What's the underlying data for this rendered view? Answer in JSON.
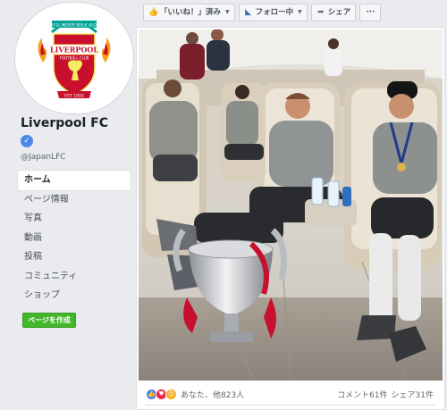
{
  "sidebar": {
    "page_name": "Liverpool FC",
    "verified_icon": "verified-check-icon",
    "handle": "@JapanLFC",
    "items": [
      {
        "label": "ホーム",
        "active": true
      },
      {
        "label": "ページ情報",
        "active": false
      },
      {
        "label": "写真",
        "active": false
      },
      {
        "label": "動画",
        "active": false
      },
      {
        "label": "投稿",
        "active": false
      },
      {
        "label": "コミュニティ",
        "active": false
      },
      {
        "label": "ショップ",
        "active": false
      }
    ],
    "create_page_label": "ページを作成",
    "logo": {
      "motto": "YOU'LL NEVER WALK ALONE",
      "name": "LIVERPOOL",
      "subtitle": "FOOTBALL CLUB",
      "est": "EST 1892"
    }
  },
  "actionbar": {
    "like_label": "「いいね！」済み",
    "follow_label": "フォロー中",
    "share_label": "シェア",
    "more_label": "···"
  },
  "post": {
    "reactions_text": "あなた、他823人",
    "comments": "コメント61件",
    "shares": "シェア31件"
  },
  "colors": {
    "fb_blue": "#4267b2",
    "green_button": "#42b72a",
    "lfc_red": "#c8102e",
    "bg": "#e9ebee"
  }
}
